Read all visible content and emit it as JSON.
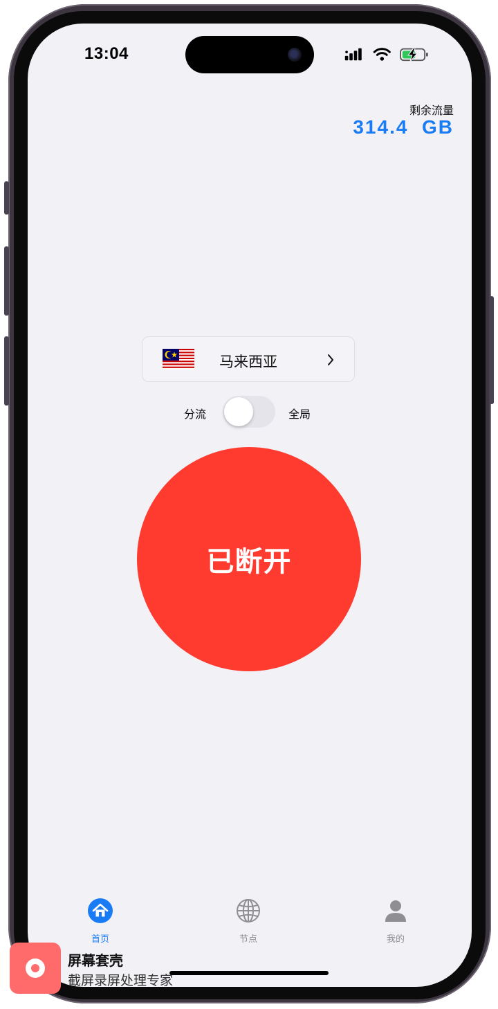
{
  "status_bar": {
    "time": "13:04"
  },
  "traffic": {
    "label": "剩余流量",
    "value": "314.4  GB"
  },
  "node": {
    "name": "马来西亚",
    "flag": "malaysia-flag-icon"
  },
  "mode": {
    "left_label": "分流",
    "right_label": "全局",
    "global_enabled": false
  },
  "connection": {
    "status_label": "已断开",
    "color": "#ff3b30"
  },
  "tabs": [
    {
      "label": "首页",
      "icon": "home-icon",
      "active": true
    },
    {
      "label": "节点",
      "icon": "globe-icon",
      "active": false
    },
    {
      "label": "我的",
      "icon": "person-icon",
      "active": false
    }
  ],
  "colors": {
    "accent": "#1a7cf5",
    "inactive": "#8e8e93",
    "background": "#f2f1f6"
  },
  "watermark": {
    "title": "屏幕套壳",
    "subtitle": "截屏录屏处理专家"
  }
}
